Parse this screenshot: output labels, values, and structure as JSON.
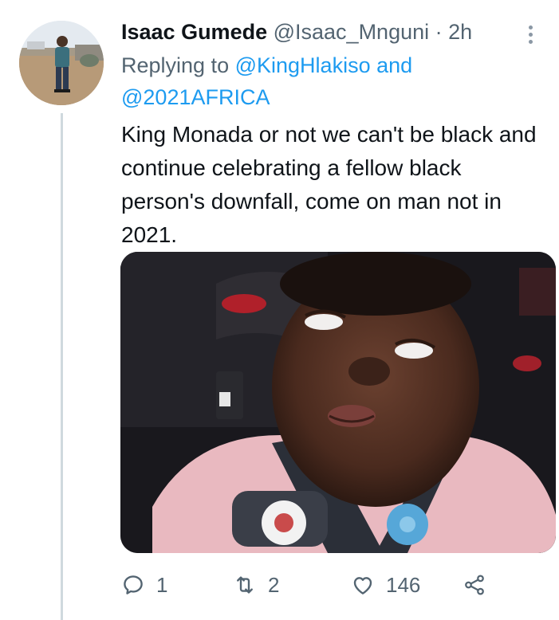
{
  "tweet": {
    "display_name": "Isaac Gumede",
    "handle": "@Isaac_Mnguni",
    "separator": "·",
    "time": "2h",
    "replying_prefix": "Replying to",
    "replying_user_1": "@KingHlakiso",
    "replying_and": "and",
    "replying_user_2": "@2021AFRICA",
    "text": "King Monada or not we can't be black and continue celebrating a fellow black person's downfall, come on man not in 2021.",
    "media_icon": "baby-eye-roll-photo"
  },
  "actions": {
    "reply_count": "1",
    "retweet_count": "2",
    "like_count": "146"
  },
  "icons": {
    "reply": "reply-icon",
    "retweet": "retweet-icon",
    "like": "heart-icon",
    "share": "share-icon",
    "more": "more-icon"
  },
  "colors": {
    "link": "#1d9bf0",
    "secondary_text": "#536471",
    "primary_text": "#0f1419",
    "thread_line": "#cfd9de"
  }
}
